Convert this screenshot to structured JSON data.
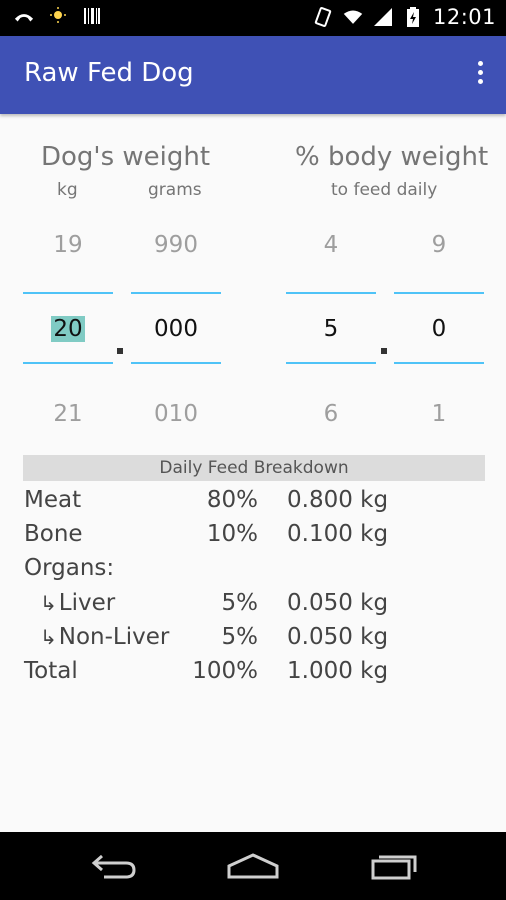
{
  "status_bar": {
    "time": "12:01",
    "left_icons": [
      "missed-call-icon",
      "sun-weather-icon",
      "barcode-icon"
    ],
    "right_icons": [
      "vibrate-icon",
      "wifi-icon",
      "signal-icon",
      "battery-charging-icon"
    ]
  },
  "app_bar": {
    "title": "Raw Fed Dog",
    "overflow_icon": "more-vert-icon"
  },
  "weight": {
    "title": "Dog's weight",
    "kg_label": "kg",
    "grams_label": "grams",
    "kg_prev": "19",
    "kg_current": "20",
    "kg_next": "21",
    "grams_prev": "990",
    "grams_current": "000",
    "grams_next": "010"
  },
  "percent": {
    "title": "% body weight",
    "subtitle": "to feed daily",
    "whole_prev": "4",
    "whole_current": "5",
    "whole_next": "6",
    "decimal_prev": "9",
    "decimal_current": "0",
    "decimal_next": "1"
  },
  "breakdown": {
    "header": "Daily Feed Breakdown",
    "rows": [
      {
        "name": "Meat",
        "percent": "80%",
        "amount": "0.800 kg"
      },
      {
        "name": "Bone",
        "percent": "10%",
        "amount": "0.100 kg"
      },
      {
        "name": "Organs:",
        "percent": "",
        "amount": ""
      },
      {
        "name": "Liver",
        "percent": "5%",
        "amount": "0.050 kg"
      },
      {
        "name": "Non-Liver",
        "percent": "5%",
        "amount": "0.050 kg"
      },
      {
        "name": "Total",
        "percent": "100%",
        "amount": "1.000 kg"
      }
    ]
  },
  "nav_bar": {
    "icons": [
      "back-icon",
      "home-icon",
      "recents-icon"
    ]
  }
}
